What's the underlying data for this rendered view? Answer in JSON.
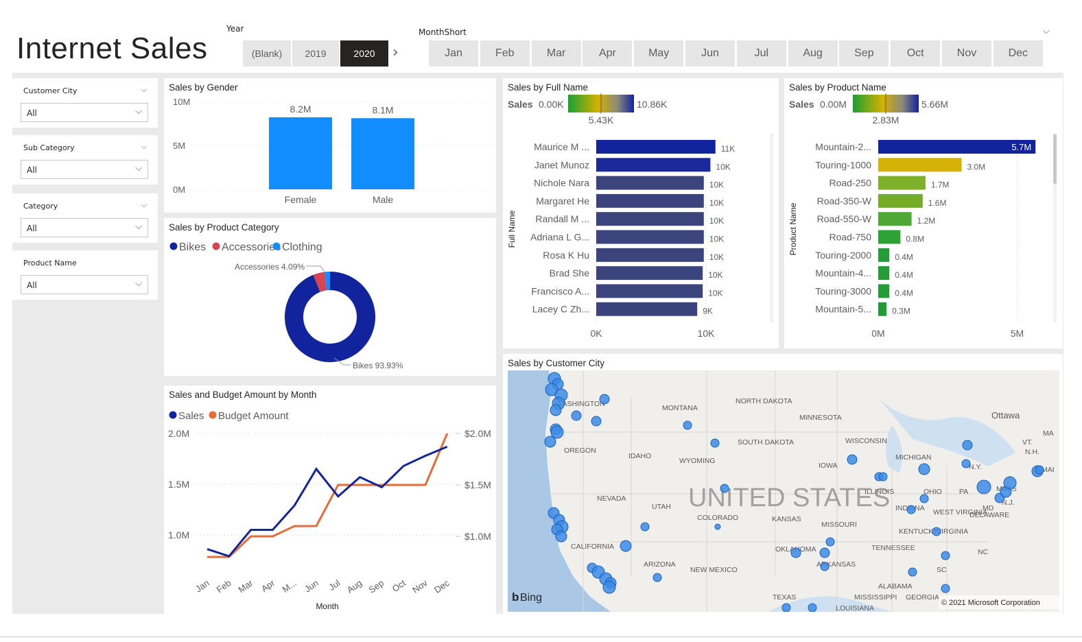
{
  "page_title": "Internet Sales",
  "year_slicer": {
    "label": "Year",
    "options": [
      "(Blank)",
      "2019",
      "2020"
    ],
    "selected": "2020",
    "next_icon": "chevron-right-icon"
  },
  "month_slicer": {
    "label": "MonthShort",
    "options": [
      "Jan",
      "Feb",
      "Mar",
      "Apr",
      "May",
      "Jun",
      "Jul",
      "Aug",
      "Sep",
      "Oct",
      "Nov",
      "Dec"
    ],
    "collapse_icon": "chevron-down-icon"
  },
  "filters": [
    {
      "label": "Customer City",
      "value": "All"
    },
    {
      "label": "Sub Category",
      "value": "All"
    },
    {
      "label": "Category",
      "value": "All"
    },
    {
      "label": "Product Name",
      "value": "All"
    }
  ],
  "colors": {
    "blue_bar": "#118dff",
    "navy": "#12239e",
    "orange": "#e66c37",
    "red": "#d64550",
    "map_dot": "#3c8be8"
  },
  "chart_data": [
    {
      "id": "gender",
      "type": "bar",
      "title": "Sales by Gender",
      "categories": [
        "Female",
        "Male"
      ],
      "values": [
        8.2,
        8.1
      ],
      "data_labels": [
        "8.2M",
        "8.1M"
      ],
      "yticks": [
        "10M",
        "5M",
        "0M"
      ],
      "ylim": [
        0,
        10
      ],
      "unit": "M"
    },
    {
      "id": "category",
      "type": "pie",
      "title": "Sales by Product Category",
      "legend": [
        "Bikes",
        "Accessories",
        "Clothing"
      ],
      "values": [
        93.93,
        4.09,
        1.98
      ],
      "colors": [
        "#12239e",
        "#d64550",
        "#118dff"
      ],
      "annotations": [
        "Accessories 4.09%",
        "Bikes 93.93%"
      ]
    },
    {
      "id": "monthly",
      "type": "line",
      "title": "Sales and Budget Amount by Month",
      "xlabel": "Month",
      "legend": [
        "Sales",
        "Budget Amount"
      ],
      "categories": [
        "Jan",
        "Feb",
        "Mar",
        "Apr",
        "M...",
        "Jun",
        "Jul",
        "Aug",
        "Sep",
        "Oct",
        "Nov",
        "Dec"
      ],
      "series": [
        {
          "name": "Sales",
          "values": [
            0.86,
            0.79,
            1.05,
            1.05,
            1.29,
            1.65,
            1.38,
            1.57,
            1.47,
            1.68,
            1.78,
            1.87
          ]
        },
        {
          "name": "Budget Amount",
          "values": [
            0.8,
            0.8,
            1.0,
            1.0,
            1.1,
            1.1,
            1.5,
            1.5,
            1.5,
            1.5,
            1.5,
            2.0
          ]
        }
      ],
      "yticks_left": [
        "2.0M",
        "1.5M",
        "1.0M"
      ],
      "yticks_right": [
        "$2.0M",
        "$1.5M",
        "$1.0M"
      ],
      "ylim_left": [
        0.7,
        2.0
      ],
      "ylim_right": [
        0.8,
        2.0
      ]
    },
    {
      "id": "fullname",
      "type": "bar",
      "orientation": "horizontal",
      "title": "Sales by Full Name",
      "ylabel": "Full Name",
      "color_legend": {
        "label": "Sales",
        "min": "0.00K",
        "mid": "5.43K",
        "max": "10.86K"
      },
      "categories": [
        "Maurice M ...",
        "Janet Munoz",
        "Nichole Nara",
        "Margaret He",
        "Randall M ...",
        "Adriana L G...",
        "Rosa K Hu",
        "Brad She",
        "Francisco A...",
        "Lacey C Zh..."
      ],
      "values": [
        10.86,
        10.4,
        9.8,
        9.8,
        9.8,
        9.8,
        9.8,
        9.7,
        9.7,
        9.2
      ],
      "data_labels": [
        "11K",
        "10K",
        "10K",
        "10K",
        "10K",
        "10K",
        "10K",
        "10K",
        "10K",
        "9K"
      ],
      "xticks": [
        "0K",
        "10K"
      ],
      "xlim": [
        0,
        10
      ]
    },
    {
      "id": "product",
      "type": "bar",
      "orientation": "horizontal",
      "title": "Sales by Product Name",
      "ylabel": "Product Name",
      "color_legend": {
        "label": "Sales",
        "min": "0.00M",
        "mid": "2.83M",
        "max": "5.66M"
      },
      "categories": [
        "Mountain-2...",
        "Touring-1000",
        "Road-250",
        "Road-350-W",
        "Road-550-W",
        "Road-750",
        "Touring-2000",
        "Mountain-4...",
        "Touring-3000",
        "Mountain-5..."
      ],
      "values": [
        5.66,
        3.0,
        1.7,
        1.6,
        1.2,
        0.8,
        0.4,
        0.4,
        0.4,
        0.3
      ],
      "data_labels": [
        "5.7M",
        "3.0M",
        "1.7M",
        "1.6M",
        "1.2M",
        "0.8M",
        "0.4M",
        "0.4M",
        "0.4M",
        "0.3M"
      ],
      "bar_colors": [
        "#12239e",
        "#d4b106",
        "#7fb02a",
        "#74ac27",
        "#4ea833",
        "#2ea136",
        "#259c38",
        "#259c38",
        "#259c38",
        "#239a38"
      ],
      "xticks": [
        "0M",
        "5M"
      ],
      "xlim": [
        0,
        5
      ]
    }
  ],
  "map": {
    "title": "Sales by Customer City",
    "country_label": "UNITED STATES",
    "bing_label": "Bing",
    "copyright": "© 2021 Microsoft Corporation",
    "state_labels": [
      "WASHINGTON",
      "MONTANA",
      "NORTH DAKOTA",
      "MINNESOTA",
      "OREGON",
      "IDAHO",
      "WYOMING",
      "SOUTH DAKOTA",
      "WISCONSIN",
      "MICHIGAN",
      "IOWA",
      "NEVADA",
      "UTAH",
      "COLORADO",
      "KANSAS",
      "MISSOURI",
      "ILLINOIS",
      "INDIANA",
      "OHIO",
      "WEST VIRGINIA",
      "VIRGINIA",
      "KENTUCKY",
      "CALIFORNIA",
      "ARIZONA",
      "NEW MEXICO",
      "OKLAHOMA",
      "ARKANSAS",
      "TENNESSEE",
      "NC",
      "SC",
      "ALABAMA",
      "GEORGIA",
      "MISSISSIPPI",
      "LOUISIANA",
      "TEXAS",
      "N.Y.",
      "PA",
      "N.J.",
      "DELAWARE",
      "MD",
      "VT.",
      "N.H.",
      "MA",
      "MAI",
      "MASS",
      "Ottawa"
    ]
  }
}
